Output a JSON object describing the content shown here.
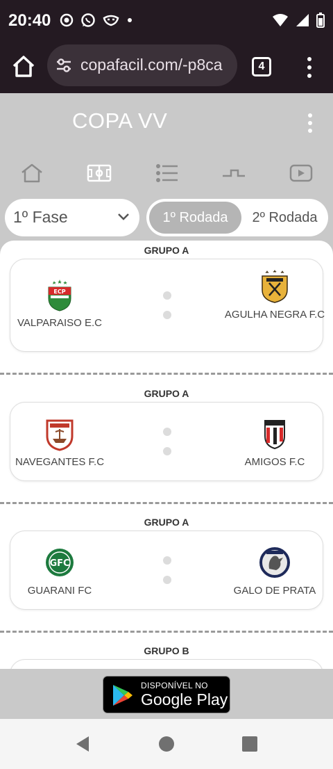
{
  "status_bar": {
    "time": "20:40",
    "notification_icons": [
      "record-icon",
      "whatsapp-icon",
      "mask-icon",
      "dot-icon"
    ],
    "system_icons": [
      "wifi-icon",
      "signal-icon",
      "battery-icon"
    ]
  },
  "browser": {
    "url": "copafacil.com/-p8ca",
    "tab_count": "4"
  },
  "app": {
    "title": "COPA VV",
    "nav_icons": [
      "home-icon",
      "field-icon",
      "list-icon",
      "bracket-icon",
      "video-icon"
    ],
    "phase_select": "1º Fase",
    "rounds": [
      "1º Rodada",
      "2º Rodada"
    ],
    "active_round": "1º Rodada"
  },
  "matches": [
    {
      "group": "GRUPO A",
      "home": {
        "name": "VALPARAISO E.C",
        "crest": "valparaiso-crest-icon"
      },
      "away": {
        "name": "AGULHA NEGRA F.C",
        "crest": "agulha-negra-crest-icon"
      }
    },
    {
      "group": "GRUPO A",
      "home": {
        "name": "NAVEGANTES F.C",
        "crest": "navegantes-crest-icon"
      },
      "away": {
        "name": "AMIGOS F.C",
        "crest": "amigos-crest-icon"
      }
    },
    {
      "group": "GRUPO A",
      "home": {
        "name": "GUARANI FC",
        "crest": "guarani-crest-icon"
      },
      "away": {
        "name": "GALO DE PRATA",
        "crest": "galo-de-prata-crest-icon"
      }
    },
    {
      "group": "GRUPO B"
    }
  ],
  "play_banner": {
    "small_text": "DISPONÍVEL NO",
    "big_text": "Google Play"
  },
  "colors": {
    "status_bar": "#241a22",
    "app_header": "#c9c9c9",
    "active_round": "#b5b5b5"
  }
}
